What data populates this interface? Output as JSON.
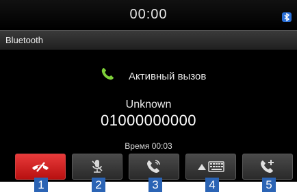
{
  "status_bar": {
    "time": "00:00",
    "bluetooth_icon": "bluetooth-icon"
  },
  "header": {
    "title": "Bluetooth"
  },
  "call": {
    "status": "Активный вызов",
    "caller_name": "Unknown",
    "caller_number": "01000000000",
    "duration": "Время 00:03",
    "status_icon": "phone-icon"
  },
  "buttons": [
    {
      "icon": "end-call-icon",
      "badge": "1"
    },
    {
      "icon": "mute-mic-icon",
      "badge": "2"
    },
    {
      "icon": "handset-transfer-icon",
      "badge": "3"
    },
    {
      "icon": "keypad-icon",
      "badge": "4"
    },
    {
      "icon": "add-call-icon",
      "badge": "5"
    }
  ],
  "colors": {
    "accent_green": "#7ed03a",
    "end_call_red": "#d81f1f",
    "badge_blue": "#2b64b5"
  }
}
